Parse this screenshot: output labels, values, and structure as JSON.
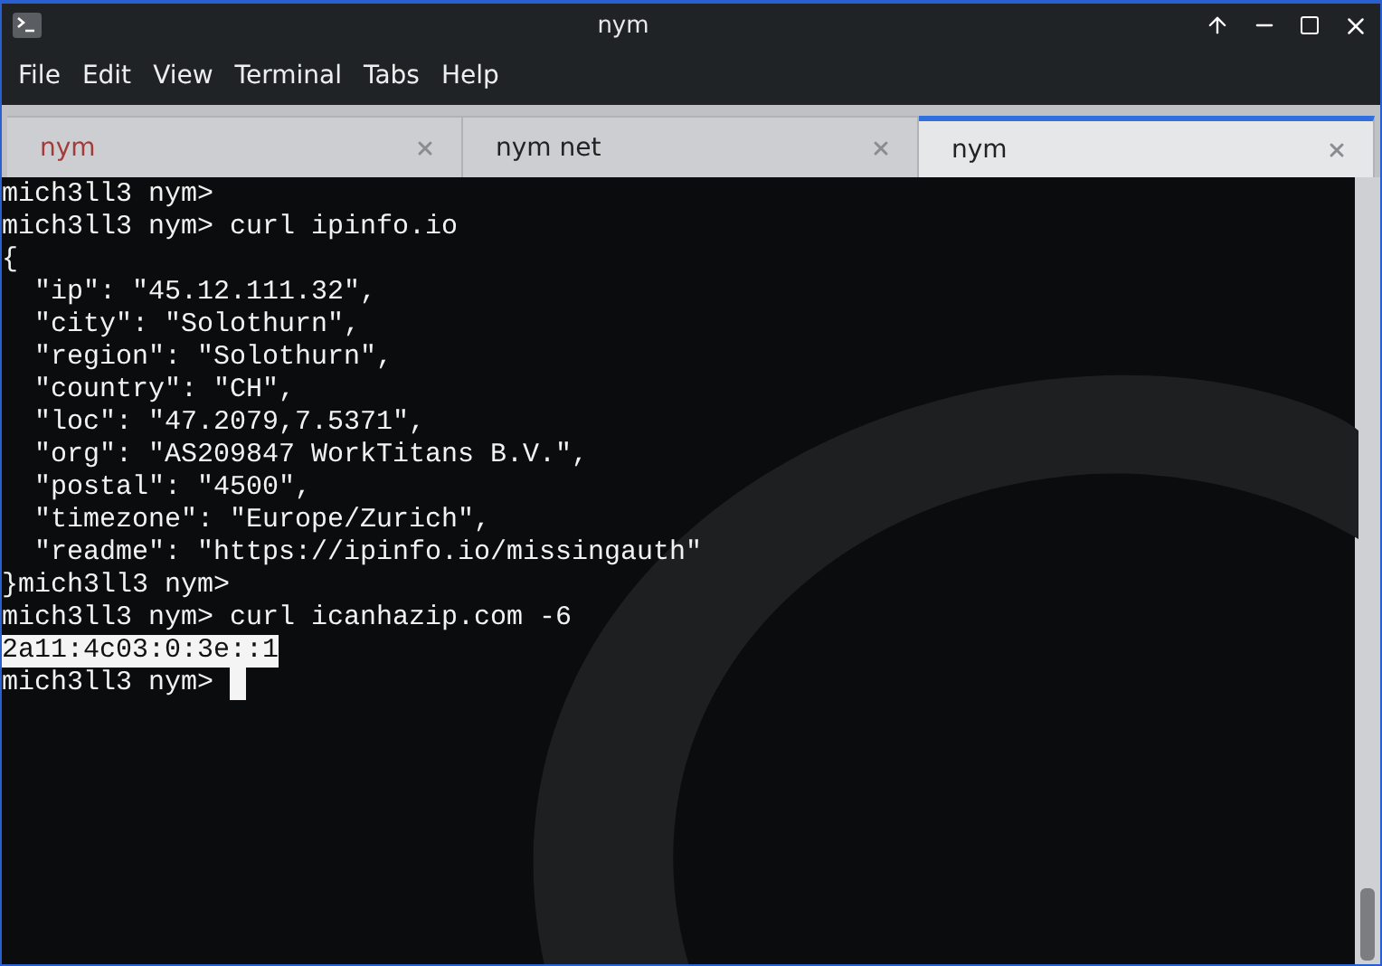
{
  "window": {
    "title": "nym"
  },
  "menu": [
    "File",
    "Edit",
    "View",
    "Terminal",
    "Tabs",
    "Help"
  ],
  "tabs": [
    {
      "label": "nym",
      "selected": false,
      "alert": true
    },
    {
      "label": "nym net",
      "selected": false,
      "alert": false
    },
    {
      "label": "nym",
      "selected": true,
      "alert": false
    }
  ],
  "terminal": {
    "lines": [
      {
        "text": "mich3ll3 nym>",
        "highlighted": false,
        "cursor": false
      },
      {
        "text": "mich3ll3 nym> curl ipinfo.io",
        "highlighted": false,
        "cursor": false
      },
      {
        "text": "{",
        "highlighted": false,
        "cursor": false
      },
      {
        "text": "  \"ip\": \"45.12.111.32\",",
        "highlighted": false,
        "cursor": false
      },
      {
        "text": "  \"city\": \"Solothurn\",",
        "highlighted": false,
        "cursor": false
      },
      {
        "text": "  \"region\": \"Solothurn\",",
        "highlighted": false,
        "cursor": false
      },
      {
        "text": "  \"country\": \"CH\",",
        "highlighted": false,
        "cursor": false
      },
      {
        "text": "  \"loc\": \"47.2079,7.5371\",",
        "highlighted": false,
        "cursor": false
      },
      {
        "text": "  \"org\": \"AS209847 WorkTitans B.V.\",",
        "highlighted": false,
        "cursor": false
      },
      {
        "text": "  \"postal\": \"4500\",",
        "highlighted": false,
        "cursor": false
      },
      {
        "text": "  \"timezone\": \"Europe/Zurich\",",
        "highlighted": false,
        "cursor": false
      },
      {
        "text": "  \"readme\": \"https://ipinfo.io/missingauth\"",
        "highlighted": false,
        "cursor": false
      },
      {
        "text": "}mich3ll3 nym>",
        "highlighted": false,
        "cursor": false
      },
      {
        "text": "mich3ll3 nym> curl icanhazip.com -6",
        "highlighted": false,
        "cursor": false
      },
      {
        "text": "2a11:4c03:0:3e::1",
        "highlighted": true,
        "cursor": false
      },
      {
        "text": "mich3ll3 nym>",
        "highlighted": false,
        "cursor": true
      }
    ]
  }
}
